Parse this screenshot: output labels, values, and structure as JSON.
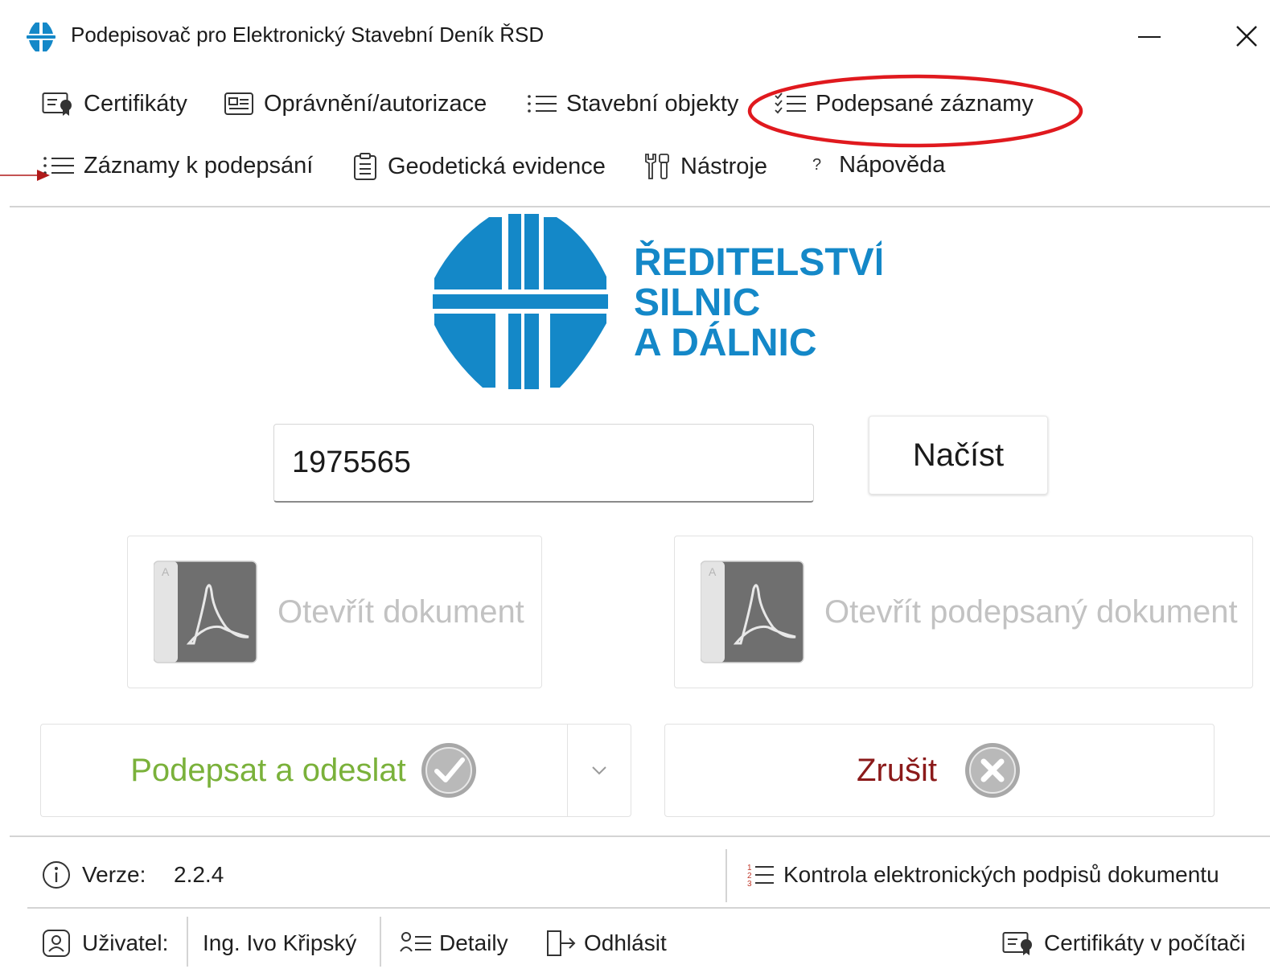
{
  "window": {
    "title": "Podepisovač pro Elektronický Stavební Deník ŘSD",
    "minimize_glyph": "—",
    "close_glyph": "✕"
  },
  "menu": {
    "row1": [
      {
        "label": "Certifikáty",
        "icon": "certificate-icon"
      },
      {
        "label": "Oprávnění/autorizace",
        "icon": "id-card-icon"
      },
      {
        "label": "Stavební objekty",
        "icon": "list-icon"
      },
      {
        "label": "Podepsané záznamy",
        "icon": "checklist-icon"
      }
    ],
    "row2": [
      {
        "label": "Záznamy k podepsání",
        "icon": "list-icon"
      },
      {
        "label": "Geodetická evidence",
        "icon": "clipboard-icon"
      },
      {
        "label": "Nástroje",
        "icon": "tools-icon"
      },
      {
        "label": "Nápověda",
        "icon": "help-icon",
        "glyph": "?"
      }
    ]
  },
  "logo": {
    "line1": "ŘEDITELSTVÍ",
    "line2": "SILNIC",
    "line3": "A DÁLNIC",
    "color": "#1488c8"
  },
  "search": {
    "value": "1975565",
    "load_button": "Načíst"
  },
  "documents": {
    "open_document": "Otevřít dokument",
    "open_signed_document": "Otevřít podepsaný dokument"
  },
  "actions": {
    "sign_and_send": "Podepsat a odeslat",
    "sign_color": "#7ab13a",
    "cancel": "Zrušit",
    "cancel_color": "#8b1a1a"
  },
  "status": {
    "version_label": "Verze:",
    "version_value": "2.2.4",
    "signature_check": "Kontrola elektronických podpisů dokumentu",
    "user_label": "Uživatel:",
    "user_name": "Ing. Ivo Křipský",
    "details": "Detaily",
    "logout": "Odhlásit",
    "computer_certs": "Certifikáty v počítači"
  },
  "annotations": {
    "highlight_color": "#e0191e",
    "arrow_color": "#b01a1a"
  }
}
